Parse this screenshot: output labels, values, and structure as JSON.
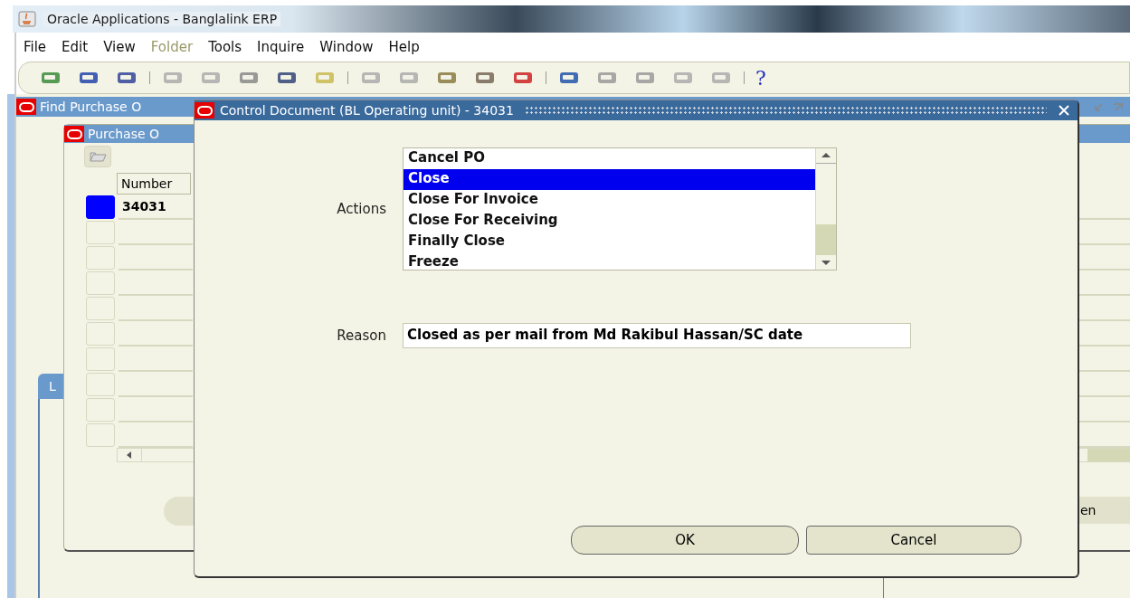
{
  "app_window": {
    "title": "Oracle Applications - Banglalink ERP"
  },
  "menu": [
    {
      "label": "File",
      "disabled": false
    },
    {
      "label": "Edit",
      "disabled": false
    },
    {
      "label": "View",
      "disabled": false
    },
    {
      "label": "Folder",
      "disabled": true
    },
    {
      "label": "Tools",
      "disabled": false
    },
    {
      "label": "Inquire",
      "disabled": false
    },
    {
      "label": "Window",
      "disabled": false
    },
    {
      "label": "Help",
      "disabled": false
    }
  ],
  "toolbar": {
    "help": "?"
  },
  "find_window": {
    "title": "Find Purchase O"
  },
  "po_window": {
    "title": "Purchase O",
    "columns": [
      "Number"
    ],
    "rows": [
      {
        "number": "34031",
        "selected": true
      },
      {
        "selected": false
      },
      {
        "selected": false
      },
      {
        "selected": false
      },
      {
        "selected": false
      },
      {
        "selected": false
      },
      {
        "selected": false
      },
      {
        "selected": false
      },
      {
        "selected": false
      },
      {
        "selected": false
      }
    ]
  },
  "region_tab": {
    "label": "L"
  },
  "side_button": {
    "label": "en"
  },
  "dialog": {
    "title": "Control Document (BL Operating unit) - 34031",
    "actions_label": "Actions",
    "actions": [
      {
        "label": "Cancel PO",
        "selected": false
      },
      {
        "label": "Close",
        "selected": true
      },
      {
        "label": "Close For Invoice",
        "selected": false
      },
      {
        "label": "Close For Receiving",
        "selected": false
      },
      {
        "label": "Finally Close",
        "selected": false
      },
      {
        "label": "Freeze",
        "selected": false
      }
    ],
    "reason_label": "Reason",
    "reason_value": "Closed as per mail from Md Rakibul Hassan/SC date",
    "buttons": [
      "OK",
      "Cancel"
    ]
  }
}
